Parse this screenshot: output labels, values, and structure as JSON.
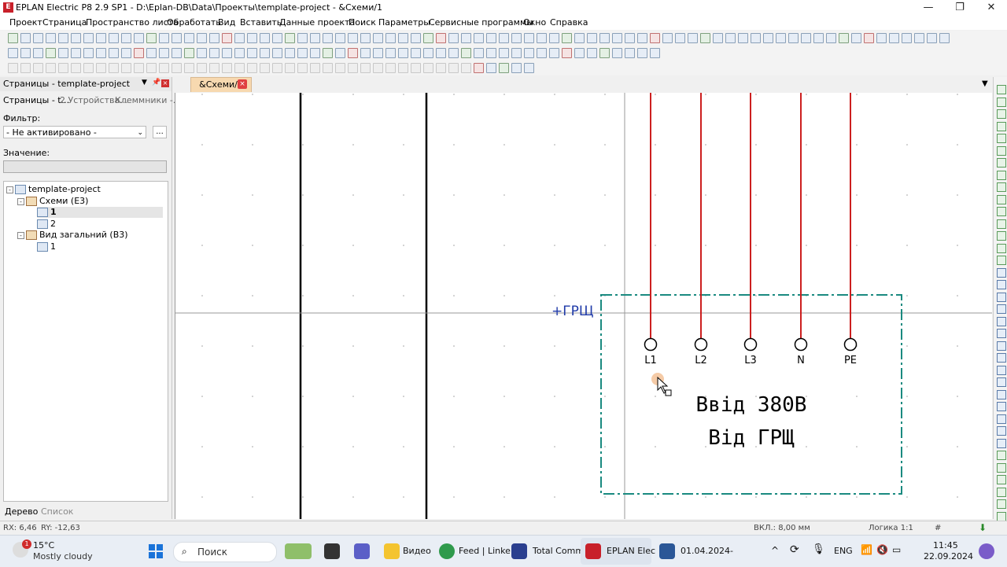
{
  "window": {
    "title": "EPLAN Electric P8 2.9 SP1 - D:\\Eplan-DB\\Data\\Проекты\\template-project - &Схеми/1",
    "app_icon": "eplan-icon",
    "controls": [
      "—",
      "❐",
      "✕"
    ]
  },
  "menu": [
    "Проект",
    "Страница",
    "Пространство листа",
    "Обработать",
    "Вид",
    "Вставить",
    "Данные проекта",
    "Поиск",
    "Параметры",
    "Сервисные программы",
    "Окно",
    "Справка"
  ],
  "left_panel": {
    "title": "Страницы - template-project",
    "tabs": [
      "Страницы - t...",
      "2 Устройства...",
      "Клеммники -..."
    ],
    "filter_label": "Фильтр:",
    "filter_value": "- Не активировано -",
    "filter_button": "...",
    "value_label": "Значение:",
    "value_text": "",
    "tree": [
      {
        "label": "template-project",
        "level": 0,
        "icon": "project-icon",
        "expander": "-"
      },
      {
        "label": "Схеми (E3)",
        "level": 1,
        "icon": "folder-icon",
        "expander": "-"
      },
      {
        "label": "1",
        "level": 2,
        "icon": "schematic-page-icon",
        "selected": true
      },
      {
        "label": "2",
        "level": 2,
        "icon": "schematic-page-icon"
      },
      {
        "label": "Вид загальний (В3)",
        "level": 1,
        "icon": "folder-icon",
        "expander": "-"
      },
      {
        "label": "1",
        "level": 2,
        "icon": "layout-page-icon"
      }
    ],
    "bottom_tabs": [
      "Дерево",
      "Список"
    ]
  },
  "document": {
    "tab_label": "&Схеми/1",
    "close": "×",
    "location_label": "+ГРЩ",
    "terminals": [
      "L1",
      "L2",
      "L3",
      "N",
      "PE"
    ],
    "box_text_line1": "Ввід 380В",
    "box_text_line2": "Від ГРЩ",
    "colors": {
      "wire": "#cc1f1f",
      "box": "#1a8a80",
      "label": "#1f3aa8"
    }
  },
  "status": {
    "rx": "RX: 6,46",
    "ry": "RY: -12,63",
    "grid": "ВКЛ.: 8,00 мм",
    "logic": "Логика 1:1",
    "hash": "#"
  },
  "taskbar": {
    "weather_temp": "15°C",
    "weather_desc": "Mostly cloudy",
    "weather_badge": "1",
    "search_placeholder": "Поиск",
    "apps": [
      "Видео",
      "Feed | Linke",
      "Total Comm",
      "EPLAN Elec",
      "01.04.2024-"
    ],
    "lang": "ENG",
    "time": "11:45",
    "date": "22.09.2024"
  }
}
